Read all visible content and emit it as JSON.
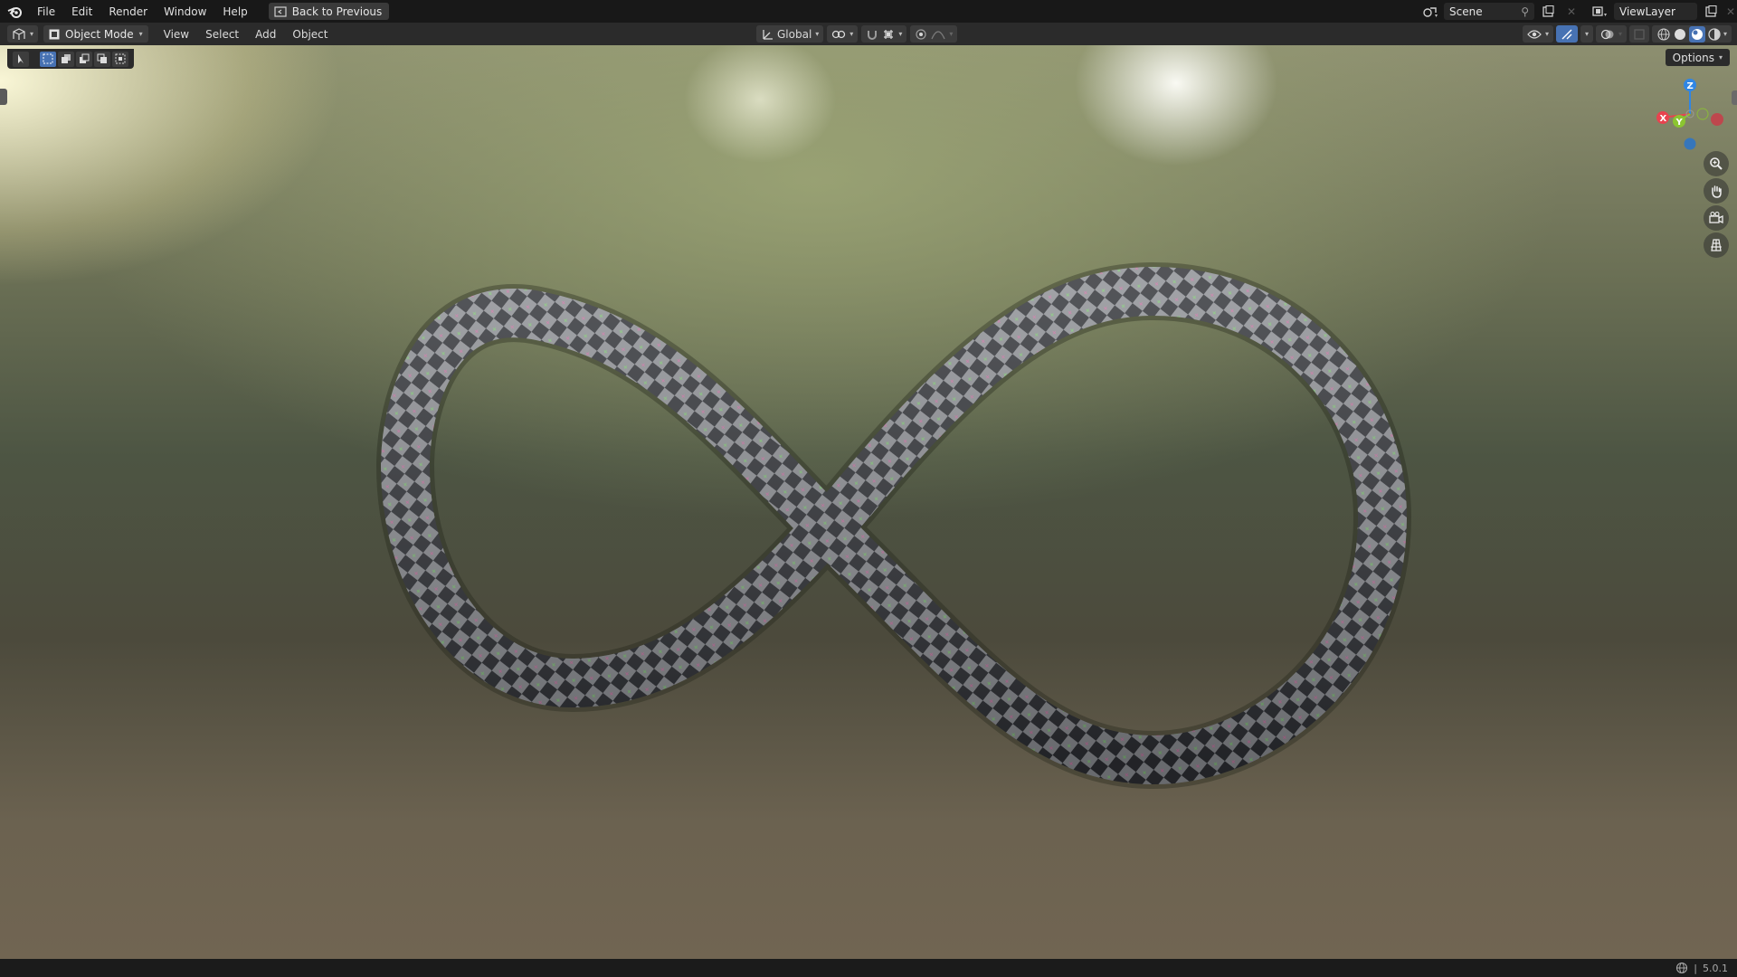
{
  "topbar": {
    "menus": [
      "File",
      "Edit",
      "Render",
      "Window",
      "Help"
    ],
    "back_label": "Back to Previous",
    "scene_name": "Scene",
    "view_layer_name": "ViewLayer"
  },
  "header": {
    "mode": "Object Mode",
    "menus": [
      "View",
      "Select",
      "Add",
      "Object"
    ],
    "transform_orientation": "Global"
  },
  "viewport": {
    "options_label": "Options",
    "gizmo": {
      "x": "X",
      "y": "Y",
      "z": "Z"
    },
    "object_description_icon": "checkered-torus-knot"
  },
  "statusbar": {
    "version": "5.0.1"
  },
  "colors": {
    "accent": "#4772b3",
    "axis_x": "#e8434f",
    "axis_y": "#8bc530",
    "axis_z": "#2f86e6"
  }
}
